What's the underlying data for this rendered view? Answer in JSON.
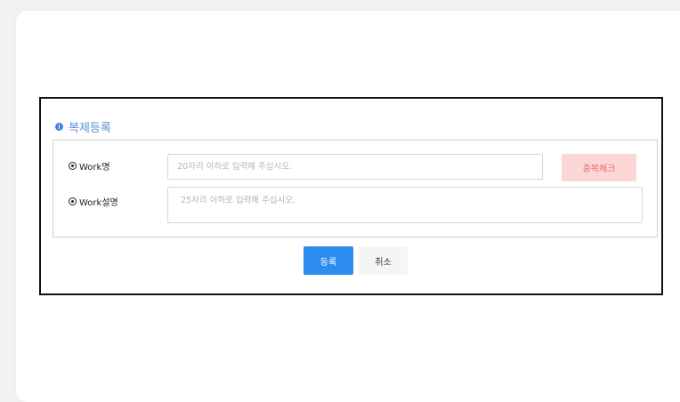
{
  "dialog": {
    "title": "복제등록"
  },
  "form": {
    "work_name": {
      "label": "Work명",
      "placeholder": "20자리 이하로 입력해 주십시오.",
      "value": ""
    },
    "duplicate_check_label": "중복체크",
    "work_desc": {
      "label": "Work설명",
      "placeholder": "25자리 이하로 입력해 주십시오.",
      "value": ""
    }
  },
  "actions": {
    "register_label": "등록",
    "cancel_label": "취소"
  },
  "colors": {
    "title_text": "#5a8fd6",
    "info_icon": "#3d82e6",
    "primary_button": "#2d8cf0",
    "duplicate_button_bg": "#fcd6d6",
    "duplicate_button_text": "#e36a6a",
    "dialog_border": "#111111"
  },
  "icons": {
    "title_icon": "info-icon",
    "label_icon": "radio-dot-icon"
  }
}
